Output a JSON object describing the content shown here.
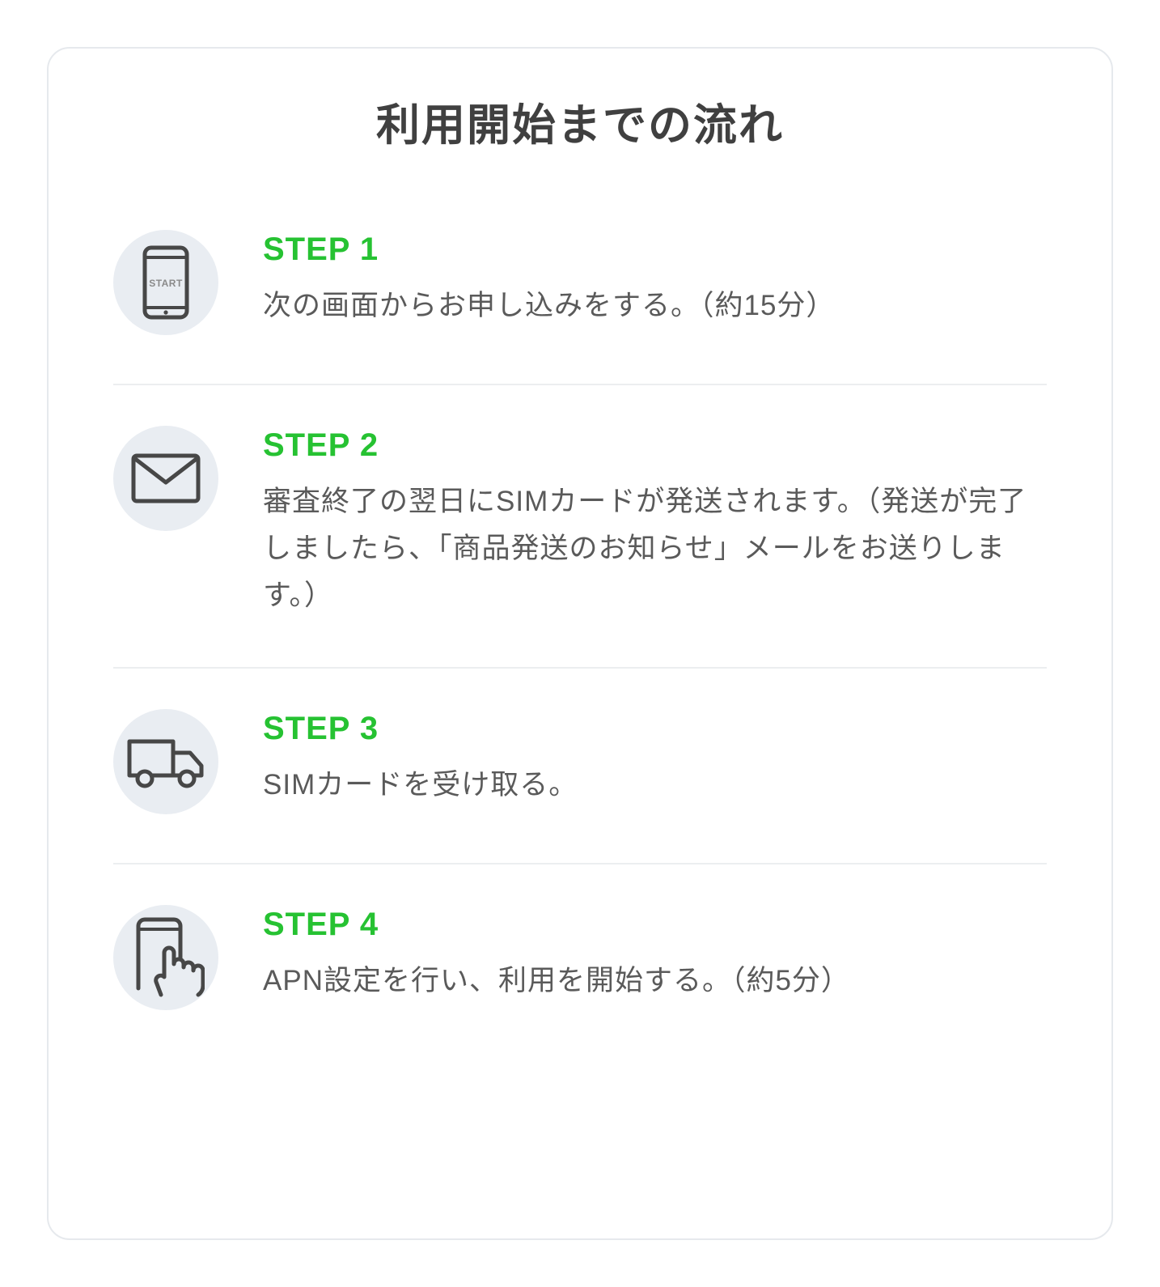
{
  "title": "利用開始までの流れ",
  "steps": [
    {
      "icon": "phone-start",
      "label": "STEP 1",
      "desc": "次の画面からお申し込みをする。（約15分）"
    },
    {
      "icon": "mail",
      "label": "STEP 2",
      "desc": "審査終了の翌日にSIMカードが発送されます。（発送が完了しましたら、「商品発送のお知らせ」メールをお送りします。）"
    },
    {
      "icon": "truck",
      "label": "STEP 3",
      "desc": "SIMカードを受け取る。"
    },
    {
      "icon": "phone-touch",
      "label": "STEP 4",
      "desc": "APN設定を行い、利用を開始する。（約5分）"
    }
  ]
}
